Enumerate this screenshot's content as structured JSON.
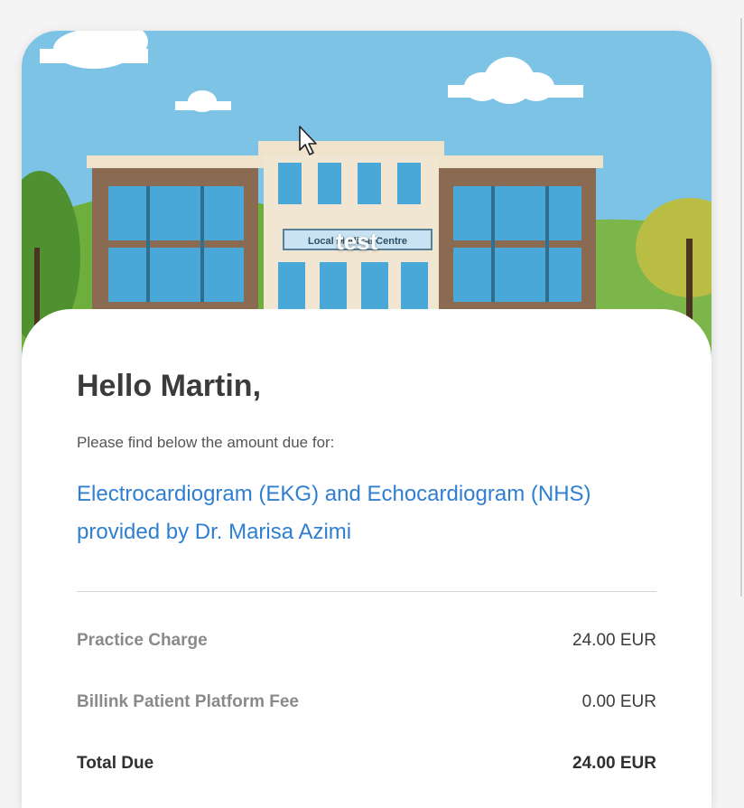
{
  "hero": {
    "building_sign": "Local Medical Centre",
    "overlay_text": "test"
  },
  "greeting": "Hello Martin,",
  "intro_text": "Please find below the amount due for:",
  "service_description": "Electrocardiogram (EKG) and Echocardiogram (NHS) provided by Dr. Marisa Azimi",
  "charges": [
    {
      "label": "Practice Charge",
      "amount": "24.00 EUR"
    },
    {
      "label": "Billink Patient Platform Fee",
      "amount": "0.00 EUR"
    }
  ],
  "total": {
    "label": "Total Due",
    "amount": "24.00 EUR"
  },
  "colors": {
    "sky": "#7cc3e6",
    "link_blue": "#2f7fd1",
    "heading": "#3b3b3b"
  }
}
